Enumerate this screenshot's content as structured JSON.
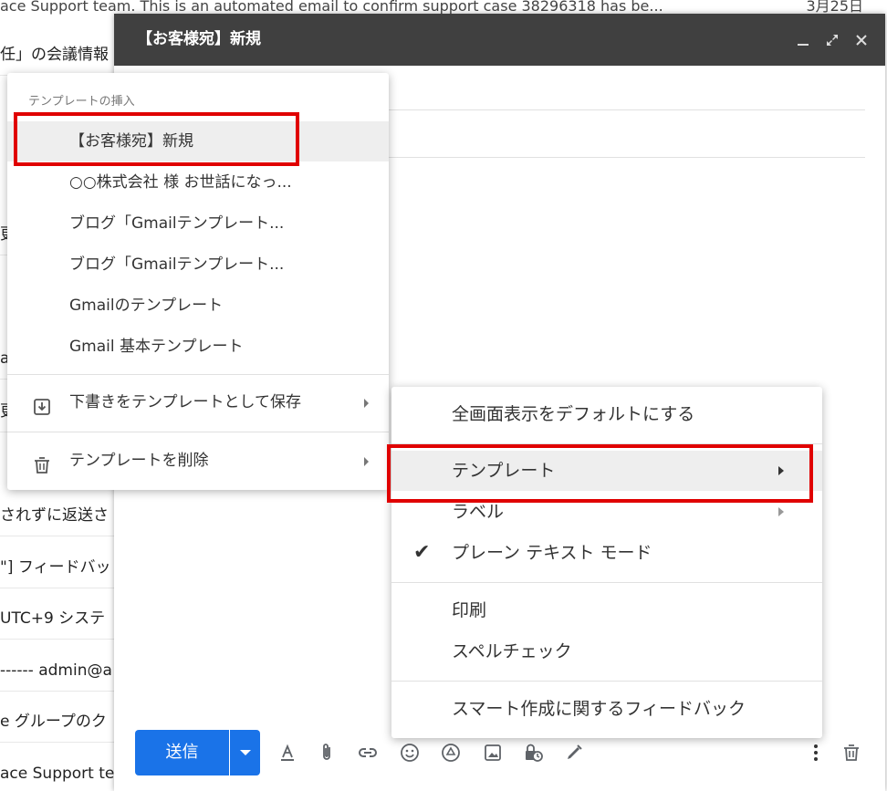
{
  "inbox": {
    "top_line": "ace Support team. This is an automated email to confirm support case 38296318 has be...",
    "top_date": "3月25日",
    "rows": [
      {
        "text": "任」の会議情報"
      },
      {
        "text": ""
      },
      {
        "text": ""
      },
      {
        "text": ""
      },
      {
        "text": "更"
      },
      {
        "text": ""
      },
      {
        "text": "a"
      },
      {
        "text": "更"
      },
      {
        "text": ""
      },
      {
        "text": ""
      },
      {
        "text": "されずに返送さ"
      },
      {
        "text": "\"] フィードバッ"
      },
      {
        "text": "UTC+9 システ"
      },
      {
        "text": "------ admin@a"
      },
      {
        "text": "e グループのク"
      },
      {
        "text": "ace Support te"
      }
    ]
  },
  "compose": {
    "title": "【お客様宛】新規",
    "send_label": "送信"
  },
  "template_menu": {
    "title": "テンプレートの挿入",
    "templates": [
      "【お客様宛】新規",
      "○○株式会社 様 お世話になっ...",
      "ブログ「Gmailテンプレート...",
      "ブログ「Gmailテンプレート...",
      "Gmailのテンプレート",
      "Gmail 基本テンプレート"
    ],
    "save_label": "下書きをテンプレートとして保存",
    "delete_label": "テンプレートを削除"
  },
  "options_menu": {
    "fullscreen_default": "全画面表示をデフォルトにする",
    "template": "テンプレート",
    "label": "ラベル",
    "plain_text": "プレーン テキスト モード",
    "print": "印刷",
    "spellcheck": "スペルチェック",
    "feedback": "スマート作成に関するフィードバック"
  },
  "colors": {
    "send_button": "#1a73e8",
    "header": "#404040",
    "highlight_box": "#e00000"
  }
}
